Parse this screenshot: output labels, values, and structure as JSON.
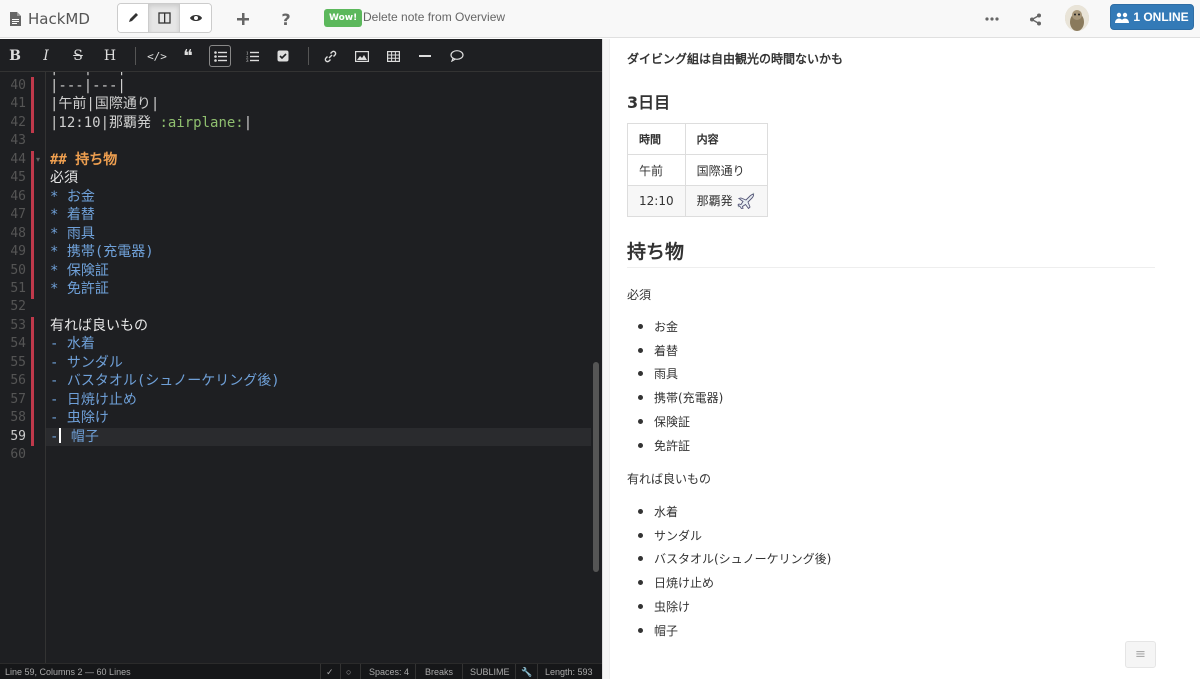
{
  "app": {
    "name": "HackMD"
  },
  "navbar": {
    "wow_badge": "Wow!",
    "wow_text": "Delete note from Overview",
    "online_label": "1 ONLINE"
  },
  "editor": {
    "lines": [
      {
        "num": "40",
        "text": "|---|---|"
      },
      {
        "num": "41",
        "text": "|午前|国際通り|"
      },
      {
        "num": "42",
        "pre": "|12:10|那覇発 ",
        "emoji": ":airplane:",
        "post": "|"
      },
      {
        "num": "43",
        "text": ""
      },
      {
        "num": "44",
        "text": "## 持ち物"
      },
      {
        "num": "45",
        "text": "必須"
      },
      {
        "num": "46",
        "text": "* お金"
      },
      {
        "num": "47",
        "text": "* 着替"
      },
      {
        "num": "48",
        "text": "* 雨具"
      },
      {
        "num": "49",
        "text": "* 携帯(充電器)"
      },
      {
        "num": "50",
        "text": "* 保険証"
      },
      {
        "num": "51",
        "text": "* 免許証"
      },
      {
        "num": "52",
        "text": ""
      },
      {
        "num": "53",
        "text": "有れば良いもの"
      },
      {
        "num": "54",
        "text": "- 水着"
      },
      {
        "num": "55",
        "text": "- サンダル"
      },
      {
        "num": "56",
        "text": "- バスタオル(シュノーケリング後)"
      },
      {
        "num": "57",
        "text": "- 日焼け止め"
      },
      {
        "num": "58",
        "text": "- 虫除け"
      },
      {
        "num": "59",
        "text": "- 帽子"
      },
      {
        "num": "60",
        "text": ""
      }
    ],
    "status": {
      "position": "Line 59, Columns 2 — 60 Lines",
      "spaces": "Spaces: 4",
      "breaks": "Breaks",
      "keymap": "SUBLIME",
      "length": "Length: 593"
    }
  },
  "preview": {
    "top_line": "ダイビング組は自由観光の時間ないかも",
    "day3_heading": "3日目",
    "table": {
      "headers": [
        "時間",
        "内容"
      ],
      "rows": [
        [
          "午前",
          "国際通り"
        ],
        [
          "12:10",
          "那覇発"
        ]
      ]
    },
    "items_heading": "持ち物",
    "required_label": "必須",
    "required_items": [
      "お金",
      "着替",
      "雨具",
      "携帯(充電器)",
      "保険証",
      "免許証"
    ],
    "optional_label": "有れば良いもの",
    "optional_items": [
      "水着",
      "サンダル",
      "バスタオル(シュノーケリング後)",
      "日焼け止め",
      "虫除け",
      "帽子"
    ]
  }
}
